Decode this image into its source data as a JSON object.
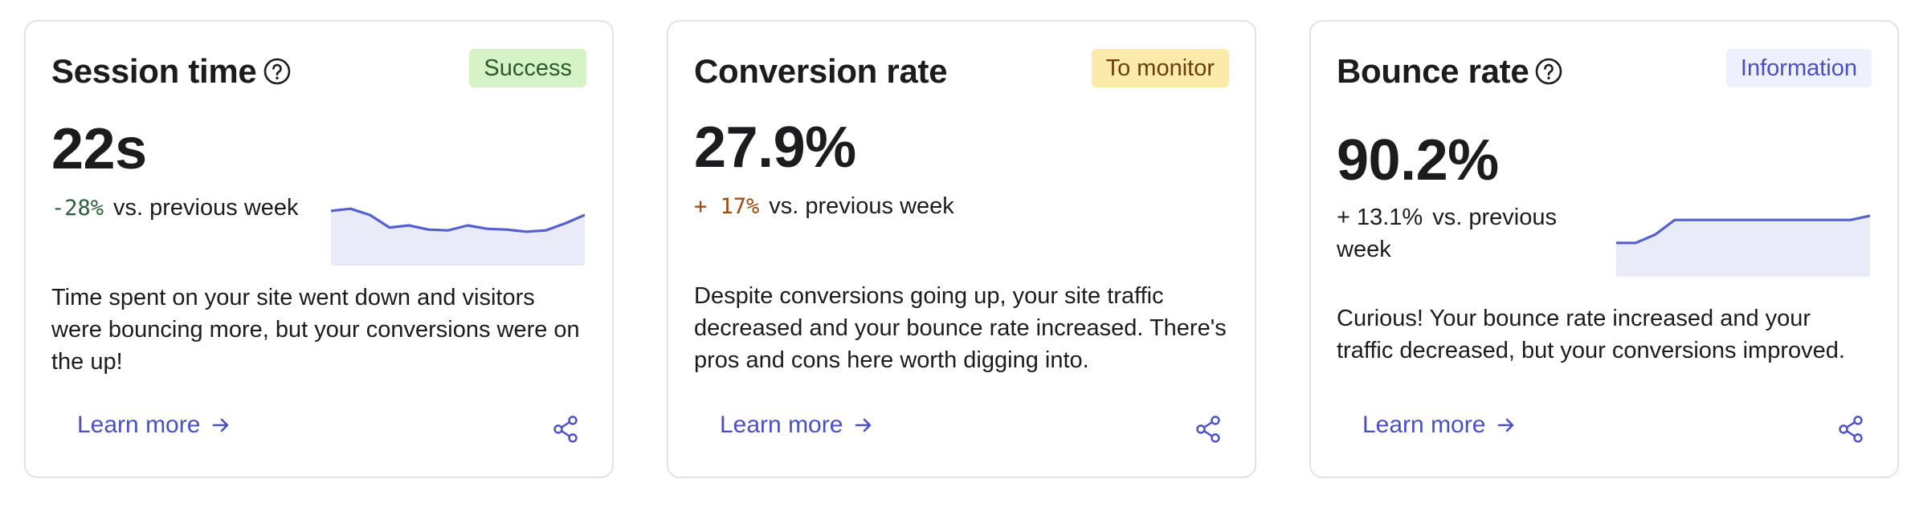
{
  "cards": [
    {
      "title": "Session time",
      "has_help": true,
      "badge": "Success",
      "metric": "22s",
      "delta_value": "-28%",
      "delta_text": "vs. previous week",
      "sparkline": [
        0.85,
        0.9,
        0.75,
        0.45,
        0.5,
        0.4,
        0.38,
        0.5,
        0.42,
        0.4,
        0.35,
        0.38,
        0.55,
        0.75
      ],
      "description": "Time spent on your site went down and visitors were bouncing more, but your conversions were on the up!",
      "learn_more": "Learn more",
      "share_icon": "share-icon"
    },
    {
      "title": "Conversion rate",
      "has_help": false,
      "badge": "To monitor",
      "metric": "27.9%",
      "delta_value": "+ 17%",
      "delta_text": "vs. previous week",
      "description": "Despite conversions going up, your site traffic decreased and your bounce rate increased. There's pros and cons here worth digging into.",
      "learn_more": "Learn more",
      "share_icon": "share-icon"
    },
    {
      "title": "Bounce rate",
      "has_help": true,
      "badge": "Information",
      "metric": "90.2%",
      "delta_value": "+ 13.1%",
      "delta_text": "vs. previous week",
      "sparkline": [
        0.35,
        0.35,
        0.55,
        0.9,
        0.9,
        0.9,
        0.9,
        0.9,
        0.9,
        0.9,
        0.9,
        0.9,
        0.9,
        1.0
      ],
      "description": "Curious! Your bounce rate increased and your traffic decreased, but your conversions improved.",
      "learn_more": "Learn more",
      "share_icon": "share-icon"
    }
  ],
  "colors": {
    "accent": "#4a4fc6",
    "success_bg": "#d6f3c7",
    "monitor_bg": "#fbeaa9",
    "info_bg": "#eef0fd",
    "sparkline_fill": "#e9ebf8",
    "sparkline_line": "#5560cf"
  }
}
